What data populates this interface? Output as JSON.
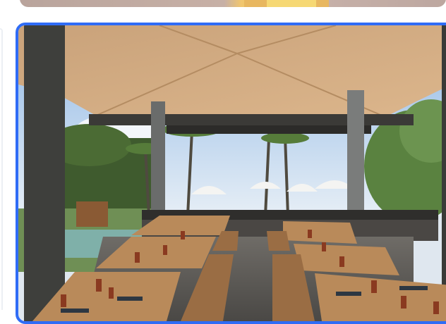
{
  "cards": [
    {
      "image_icon": "restaurant-photo-icon",
      "selected": true
    }
  ],
  "colors": {
    "selection_border": "#2f6cf6"
  }
}
